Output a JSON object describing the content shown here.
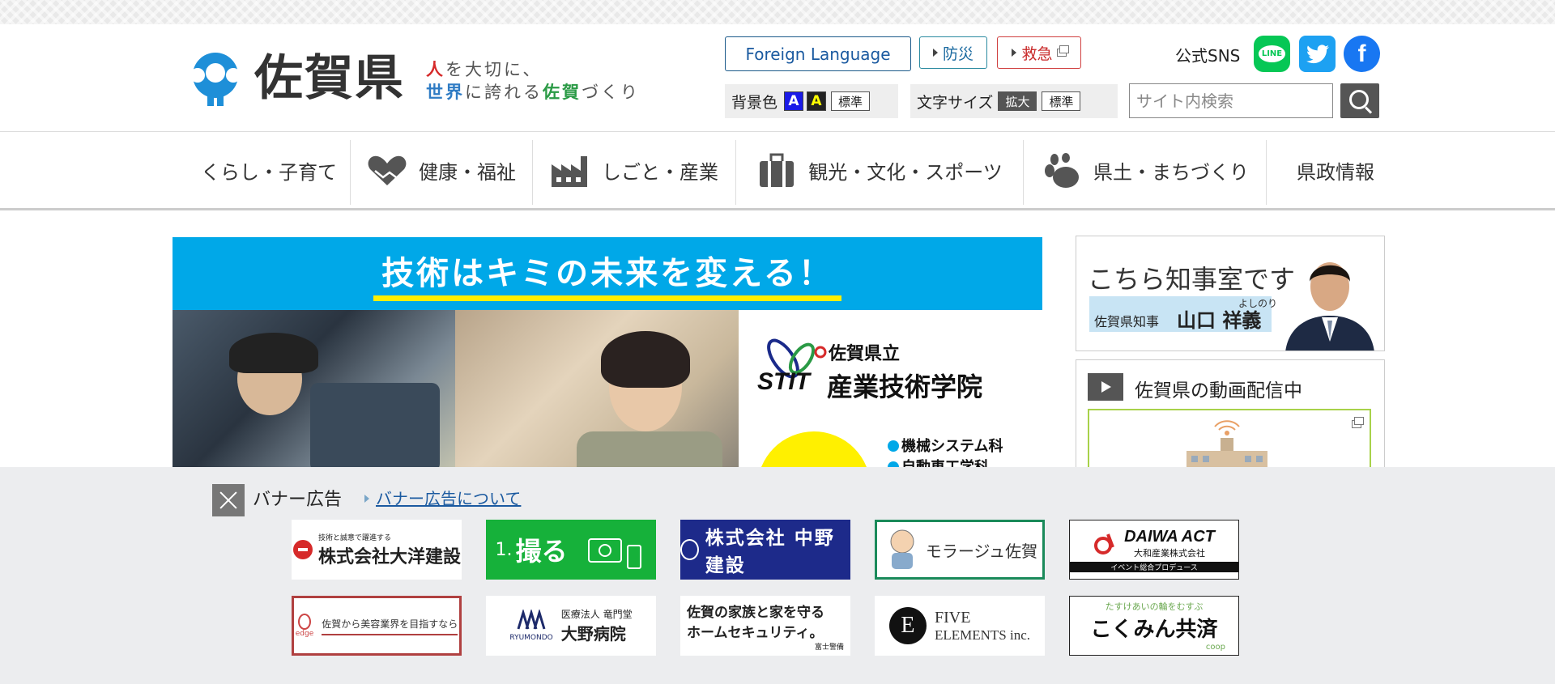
{
  "header": {
    "logo_text": "佐賀県",
    "tagline": {
      "part1_red": "人",
      "part1_rest": "を大切に、",
      "part2_blue": "世界",
      "part2_mid": "に誇れる",
      "part2_green": "佐賀",
      "part2_end": "づくり"
    },
    "foreign_language_label": "Foreign Language",
    "bousai_label": "防災",
    "kyukyu_label": "救急",
    "sns_label": "公式SNS",
    "sns_line_label": "LINE",
    "sns_twitter_icon": "twitter-bird-icon",
    "sns_facebook_label": "f",
    "background_color_label": "背景色",
    "bg_option_a1": "A",
    "bg_option_a2": "A",
    "bg_standard_label": "標準",
    "font_size_label": "文字サイズ",
    "font_enlarge_label": "拡大",
    "font_standard_label": "標準",
    "search_placeholder": "サイト内検索"
  },
  "nav": {
    "items": [
      {
        "label": "くらし・子育て",
        "icon": ""
      },
      {
        "label": "健康・福祉",
        "icon": "handshake-heart-icon"
      },
      {
        "label": "しごと・産業",
        "icon": "factory-icon"
      },
      {
        "label": "観光・文化・スポーツ",
        "icon": "suitcase-icon"
      },
      {
        "label": "県土・まちづくり",
        "icon": "footprint-icon"
      },
      {
        "label": "県政情報",
        "icon": ""
      }
    ]
  },
  "main_banner": {
    "headline": "技術はキミの未来を変える！",
    "logo_text": "STIT",
    "subtitle": "佐賀県立",
    "title": "産業技術学院",
    "courses": [
      "機械システム科",
      "自動車工学科"
    ]
  },
  "governor_card": {
    "title": "こちら知事室です",
    "role": "佐賀県知事",
    "name": "山口 祥義",
    "ruby": "よしのり"
  },
  "video_card": {
    "title": "佐賀県の動画配信中"
  },
  "ads": {
    "heading": "バナー広告",
    "about_link": "バナー広告について",
    "banners": [
      {
        "small": "技術と誠意で躍進する",
        "main": "株式会社大洋建設"
      },
      {
        "prefix": "1.",
        "main": "撮る"
      },
      {
        "main": "株式会社 中野建設"
      },
      {
        "main": "モラージュ佐賀"
      },
      {
        "main": "DAIWA ACT",
        "sub": "大和産業株式会社",
        "sub2": "イベント総合プロデュース"
      },
      {
        "main": "佐賀から美容業界を目指すなら",
        "small": "edge"
      },
      {
        "small": "RYUMONDO",
        "sub": "医療法人 竜門堂",
        "main": "大野病院"
      },
      {
        "main": "佐賀の家族と家を守る",
        "sub": "ホームセキュリティ。",
        "small": "富士警備"
      },
      {
        "main": "FIVE",
        "sub": "ELEMENTS inc."
      },
      {
        "small": "たすけあいの輪をむすぶ",
        "main": "こくみん共済",
        "sub": "coop"
      }
    ]
  }
}
